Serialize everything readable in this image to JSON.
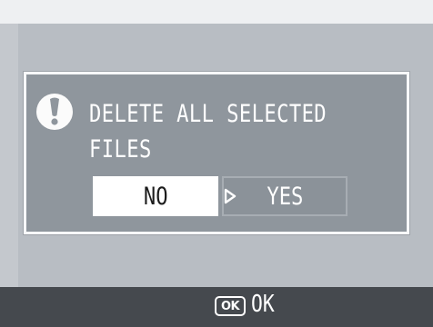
{
  "dialog": {
    "message_line1": "DELETE ALL SELECTED",
    "message_line2": "FILES",
    "buttons": {
      "no_label": "NO",
      "yes_label": "YES"
    },
    "selected": "yes"
  },
  "footer": {
    "key_label": "OK",
    "action_label": "OK"
  },
  "icons": {
    "alert": "exclamation-icon",
    "cursor": "triangle-right-icon"
  },
  "colors": {
    "screen_bg": "#b8bdc3",
    "dialog_bg": "#8f969d",
    "dialog_border": "#f7f8f9",
    "footer_bg": "#45494e",
    "no_button_bg": "#ffffff",
    "yes_button_bg": "#8b9299"
  }
}
